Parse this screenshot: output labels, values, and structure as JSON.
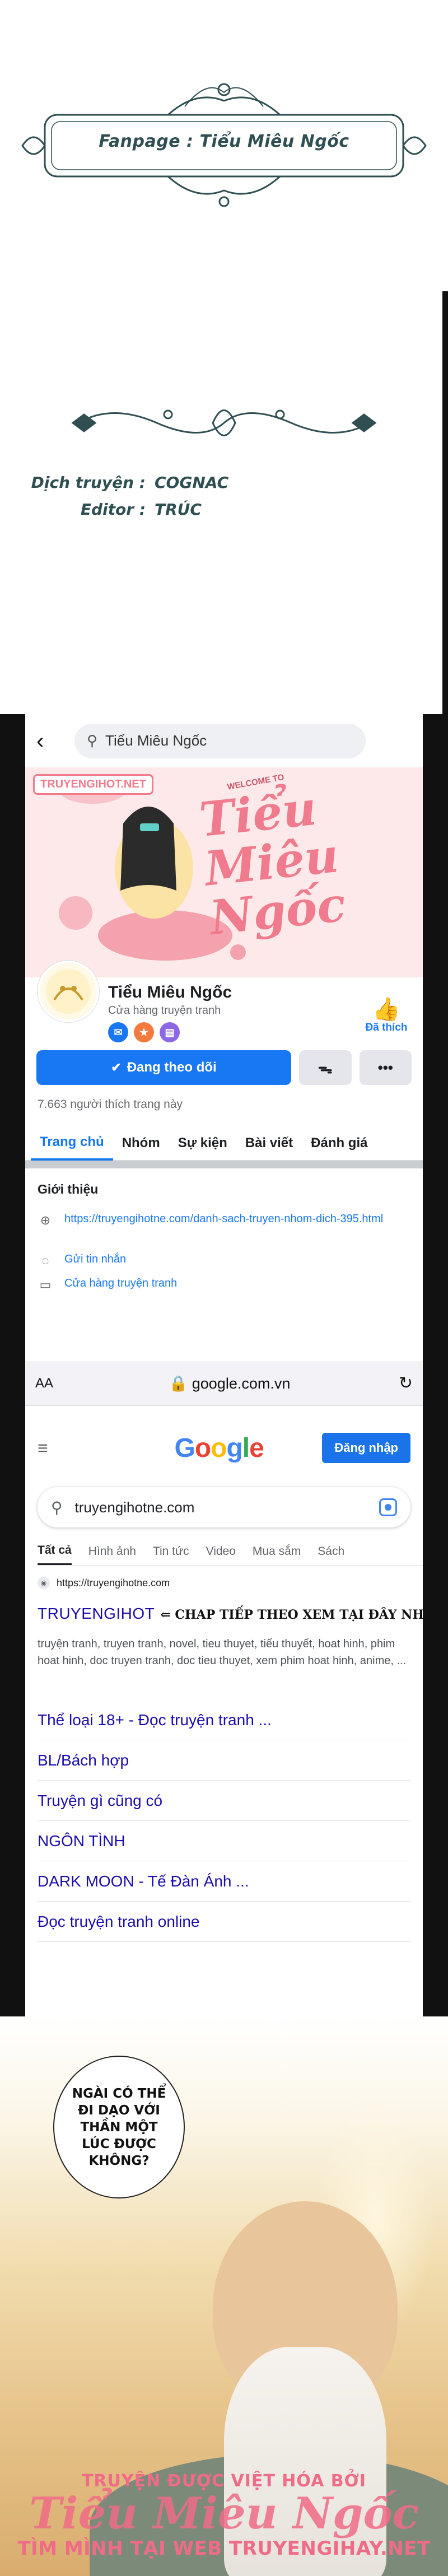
{
  "intro": {
    "fanpage": "Fanpage : Tiểu Miêu Ngốc",
    "translator_label": "Dịch truyện :",
    "translator_name": "COGNAC",
    "editor_label": "Editor :",
    "editor_name": "TRÚC"
  },
  "facebook": {
    "search_text": "Tiểu Miêu Ngốc",
    "cover": {
      "site_badge": "TRUYENGIHOT.NET",
      "welcome": "WELCOME TO",
      "title": "Tiểu Miêu Ngốc"
    },
    "page_name": "Tiểu Miêu Ngốc",
    "category": "Cửa hàng truyện tranh",
    "liked_label": "Đã thích",
    "follow_button": "Đang theo dõi",
    "more_button": "•••",
    "likes_count": "7.663 người thích trang này",
    "tabs": [
      "Trang chủ",
      "Nhóm",
      "Sự kiện",
      "Bài viết",
      "Đánh giá"
    ],
    "intro_heading": "Giới thiệu",
    "info": {
      "website": "https://truyengihotne.com/danh-sach-truyen-nhom-dich-395.html",
      "message": "Gửi tin nhắn",
      "category": "Cửa hàng truyện tranh"
    }
  },
  "safari": {
    "aa": "AA",
    "url": "google.com.vn"
  },
  "google": {
    "logo": "Google",
    "signin": "Đăng nhập",
    "query": "truyengihotne.com",
    "tabs": [
      "Tất cả",
      "Hình ảnh",
      "Tin tức",
      "Video",
      "Mua sắm",
      "Sách"
    ],
    "result": {
      "source": "https://truyengihotne.com",
      "title": "TRUYENGIHOT",
      "cta": "⇐ CHAP TIẾP THEO XEM TẠI ĐÂY NHA",
      "description": "truyện tranh, truyen tranh, novel, tieu thuyet, tiểu thuyết, hoat hinh, phim hoat hinh, doc truyen tranh, doc tieu thuyet, xem phim hoat hinh, anime, ..."
    },
    "sitelinks": [
      "Thể loại 18+ - Đọc truyện tranh ...",
      "BL/Bách hợp",
      "Truyện gì cũng có",
      "NGÔN TÌNH",
      "DARK MOON - Tế Đàn Ánh ...",
      "Đọc truyện tranh online"
    ]
  },
  "manga": {
    "speech": "NGÀI CÓ THỂ ĐI DẠO VỚI THẦN MỘT LÚC ĐƯỢC KHÔNG?",
    "watermark_top": "TRUYỆN ĐƯỢC VIỆT HÓA BỞI",
    "watermark_mid": "Tiểu Miêu Ngốc",
    "watermark_bot": "TÌM MÌNH TẠI WEB TRUYENGIHAY.NET"
  },
  "colors": {
    "facebook_blue": "#1877f2",
    "google_blue": "#1a73e8",
    "link_blue": "#1a0dab",
    "watermark_pink": "#f06b87",
    "ornament_green": "#2f4f52"
  }
}
